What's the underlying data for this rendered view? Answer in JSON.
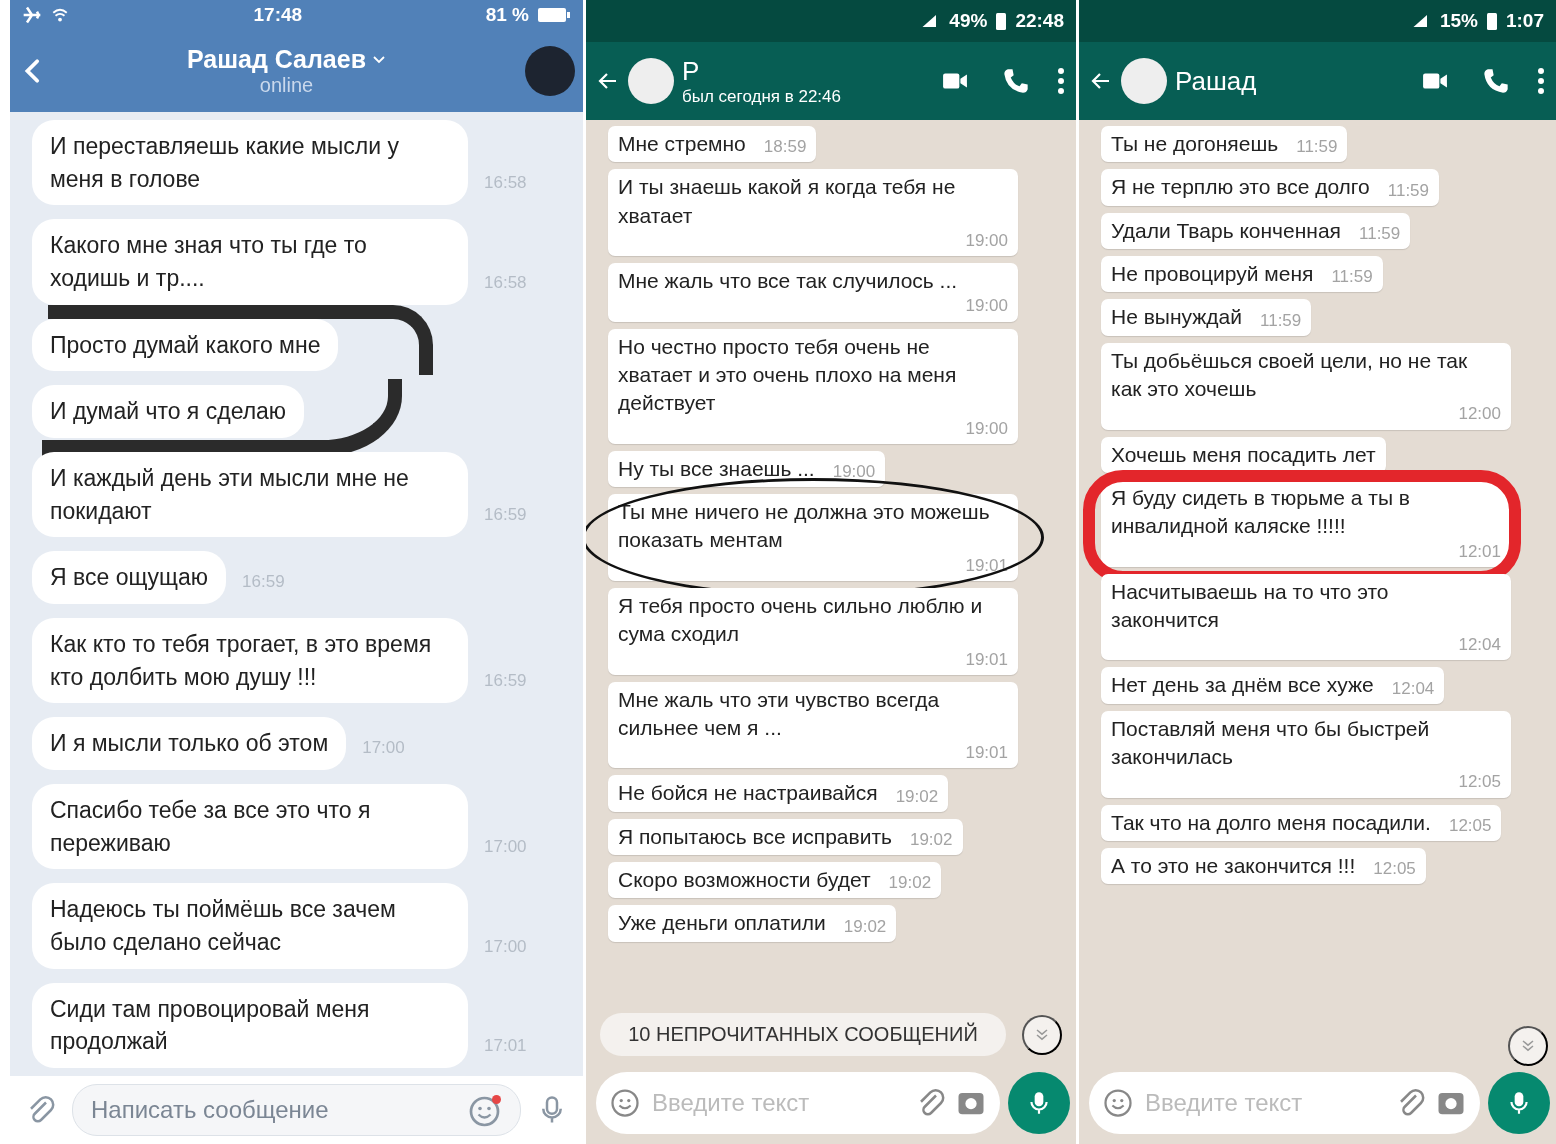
{
  "panels": [
    {
      "kind": "vk",
      "status_bar": {
        "time": "17:48",
        "battery": "81 %"
      },
      "header": {
        "title": "Рашад Салаев",
        "subtitle": "online"
      },
      "messages": [
        {
          "kind": "plain",
          "text": "И переставляешь какие мысли у меня в голове",
          "time": "16:58"
        },
        {
          "kind": "plain",
          "text": "Какого мне зная что ты где то ходишь и тр....",
          "time": "16:58"
        },
        {
          "kind": "scribbled",
          "text": "Просто думай какого мне"
        },
        {
          "kind": "scribbled",
          "text": "И думай что я сделаю"
        },
        {
          "kind": "plain",
          "text": "И каждый день эти мысли мне не покидают",
          "time": "16:59"
        },
        {
          "kind": "plain",
          "text": "Я все ощущаю",
          "time": "16:59"
        },
        {
          "kind": "plain",
          "text": "Как кто то тебя трогает, в это время кто долбить мою душу !!!",
          "time": "16:59"
        },
        {
          "kind": "plain",
          "text": "И я мысли только об этом",
          "time": "17:00"
        },
        {
          "kind": "plain",
          "text": "Спасибо тебе за все это что я переживаю",
          "time": "17:00"
        },
        {
          "kind": "plain",
          "text": "Надеюсь ты поймёшь все зачем было сделано сейчас",
          "time": "17:00"
        },
        {
          "kind": "plain",
          "text": "Сиди там провоцировай меня продолжай",
          "time": "17:01"
        }
      ],
      "composer": {
        "placeholder": "Написать сообщение"
      }
    },
    {
      "kind": "whatsapp",
      "status_bar": {
        "time": "22:48",
        "battery": "49%"
      },
      "header": {
        "title": "Р",
        "subtitle": "был сегодня в 22:46"
      },
      "messages": [
        {
          "kind": "plain",
          "text": "Мне стремно",
          "time": "18:59"
        },
        {
          "kind": "plain",
          "text": "И ты знаешь какой я когда тебя не хватает",
          "time": "19:00"
        },
        {
          "kind": "plain",
          "text": "Мне жаль что все так случилось ...",
          "time": "19:00"
        },
        {
          "kind": "plain",
          "text": "Но честно просто тебя очень не хватает и это очень плохо на меня действует",
          "time": "19:00"
        },
        {
          "kind": "plain",
          "text": "Ну ты все знаешь ...",
          "time": "19:00"
        },
        {
          "kind": "circled",
          "text": "Ты мне ничего не должна это можешь показать ментам",
          "time": "19:01"
        },
        {
          "kind": "plain",
          "text": "Я тебя просто очень сильно люблю и сума сходил",
          "time": "19:01"
        },
        {
          "kind": "plain",
          "text": "Мне жаль что эти чувство всегда сильнее чем я ...",
          "time": "19:01"
        },
        {
          "kind": "plain",
          "text": "Не бойся не настраивайся",
          "time": "19:02"
        },
        {
          "kind": "plain",
          "text": "Я попытаюсь все исправить",
          "time": "19:02"
        },
        {
          "kind": "plain",
          "text": "Скоро возможности будет",
          "time": "19:02"
        },
        {
          "kind": "plain",
          "text": "Уже деньги оплатили",
          "time": "19:02"
        }
      ],
      "unread_banner": "10 НЕПРОЧИТАННЫХ СООБЩЕНИЙ",
      "composer": {
        "placeholder": "Введите текст"
      }
    },
    {
      "kind": "whatsapp",
      "status_bar": {
        "time": "1:07",
        "battery": "15%"
      },
      "header": {
        "title": "Рашад"
      },
      "messages": [
        {
          "kind": "plain",
          "text": "Ты не догоняешь",
          "time": "11:59"
        },
        {
          "kind": "plain",
          "text": "Я не терплю это все долго",
          "time": "11:59"
        },
        {
          "kind": "plain",
          "text": "Удали Тварь конченная",
          "time": "11:59"
        },
        {
          "kind": "plain",
          "text": "Не провоцируй меня",
          "time": "11:59"
        },
        {
          "kind": "plain",
          "text": "Не вынуждай",
          "time": "11:59"
        },
        {
          "kind": "plain",
          "text": "Ты добьёшься своей цели, но не так как это хочешь",
          "time": "12:00"
        },
        {
          "kind": "plain",
          "text": "Хочешь меня посадить лет"
        },
        {
          "kind": "looped",
          "text": "Я буду сидеть в тюрьме а ты в инвалидной каляске !!!!!",
          "time": "12:01"
        },
        {
          "kind": "plain",
          "text": "Насчитываешь на то что это закончится",
          "time": "12:04"
        },
        {
          "kind": "plain",
          "text": "Нет день за днём все хуже",
          "time": "12:04"
        },
        {
          "kind": "plain",
          "text": "Поставляй меня что бы быстрей закончилась",
          "time": "12:05"
        },
        {
          "kind": "plain",
          "text": "Так что на долго меня посадили.",
          "time": "12:05"
        },
        {
          "kind": "plain",
          "text": "А то это не закончится !!!",
          "time": "12:05"
        }
      ],
      "composer": {
        "placeholder": "Введите текст"
      }
    }
  ]
}
